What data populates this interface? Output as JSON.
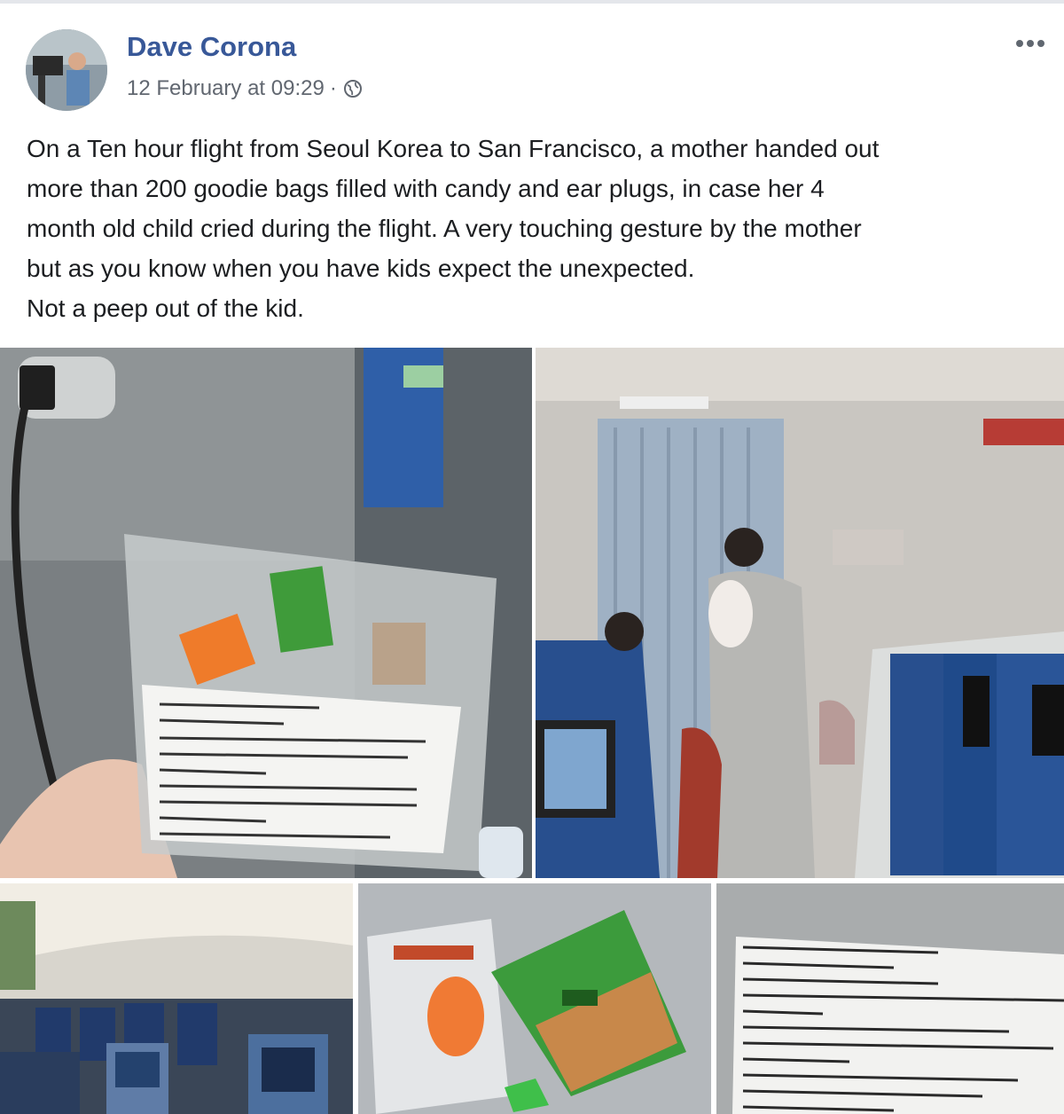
{
  "post": {
    "author": "Dave Corona",
    "timestamp": "12 February at 09:29",
    "separator": "·",
    "privacy_icon": "globe-icon",
    "more_icon": "more-options-icon",
    "text_lines": [
      "On a Ten hour flight from Seoul Korea to San Francisco, a mother handed out",
      "more than 200 goodie bags filled with candy and ear plugs, in case her 4",
      "month old child cried during the flight. A very touching gesture by the mother",
      "but as you know when you have kids expect the unexpected.",
      "Not a peep out of the kid."
    ]
  },
  "colors": {
    "author_link": "#385898",
    "meta_text": "#616770",
    "body_text": "#1c1e21"
  }
}
